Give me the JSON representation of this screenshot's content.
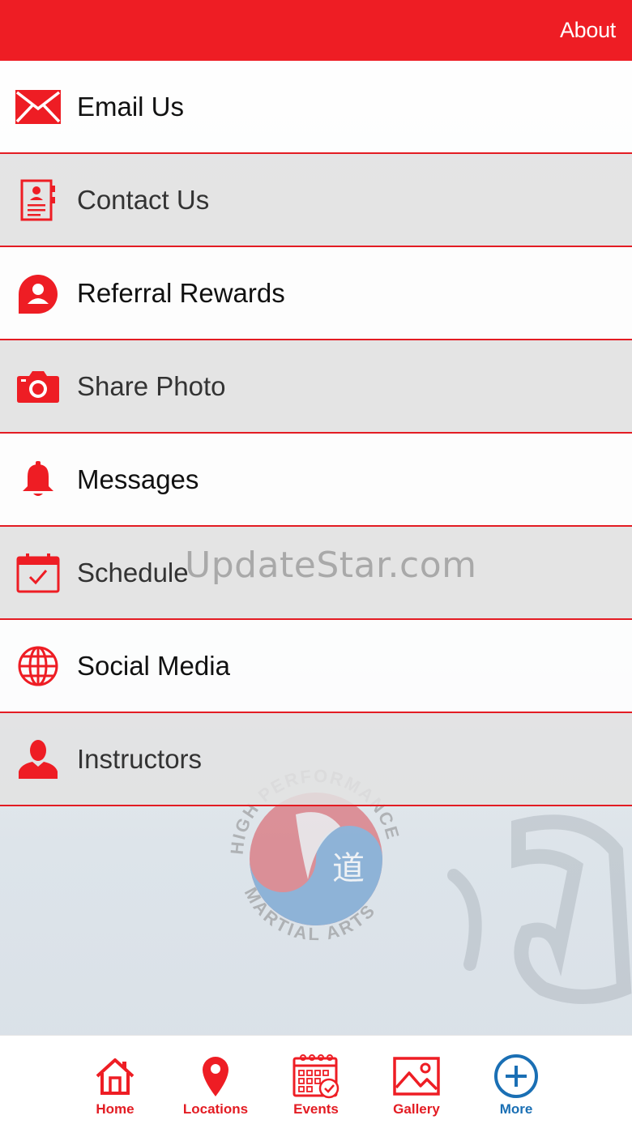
{
  "header": {
    "title": "About"
  },
  "menu": {
    "items": [
      {
        "label": "Email Us",
        "icon": "envelope-icon"
      },
      {
        "label": "Contact Us",
        "icon": "contact-card-icon"
      },
      {
        "label": "Referral Rewards",
        "icon": "referral-user-icon"
      },
      {
        "label": "Share Photo",
        "icon": "camera-icon"
      },
      {
        "label": "Messages",
        "icon": "bell-icon"
      },
      {
        "label": "Schedule",
        "icon": "calendar-check-icon"
      },
      {
        "label": "Social Media",
        "icon": "globe-icon"
      },
      {
        "label": "Instructors",
        "icon": "person-icon"
      }
    ]
  },
  "background": {
    "logo_text_top": "HIGH PERFORMANCE",
    "logo_text_bottom": "MARTIAL ARTS",
    "logo_glyph": "道"
  },
  "watermark": "UpdateStar.com",
  "tabbar": {
    "tabs": [
      {
        "label": "Home",
        "icon": "home-icon"
      },
      {
        "label": "Locations",
        "icon": "map-pin-icon"
      },
      {
        "label": "Events",
        "icon": "calendar-grid-icon"
      },
      {
        "label": "Gallery",
        "icon": "image-icon"
      },
      {
        "label": "More",
        "icon": "plus-circle-icon"
      }
    ]
  },
  "colors": {
    "accent": "#ee1d24",
    "more": "#1a6fb4"
  }
}
